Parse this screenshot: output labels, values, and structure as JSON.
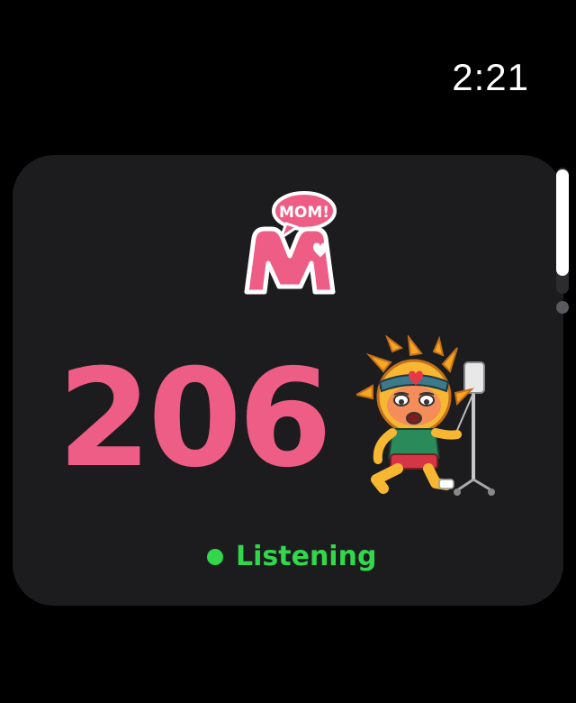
{
  "status_bar": {
    "time": "2:21"
  },
  "card": {
    "logo": {
      "bubble_text": "MOM!",
      "letter": "M"
    },
    "count": "206",
    "mascot_icon": "sick-sun-mascot-icon",
    "status": {
      "label": "Listening",
      "color": "#32d74b"
    }
  },
  "colors": {
    "accent": "#ee5d86",
    "background": "#000000",
    "card": "#1c1c1e"
  }
}
